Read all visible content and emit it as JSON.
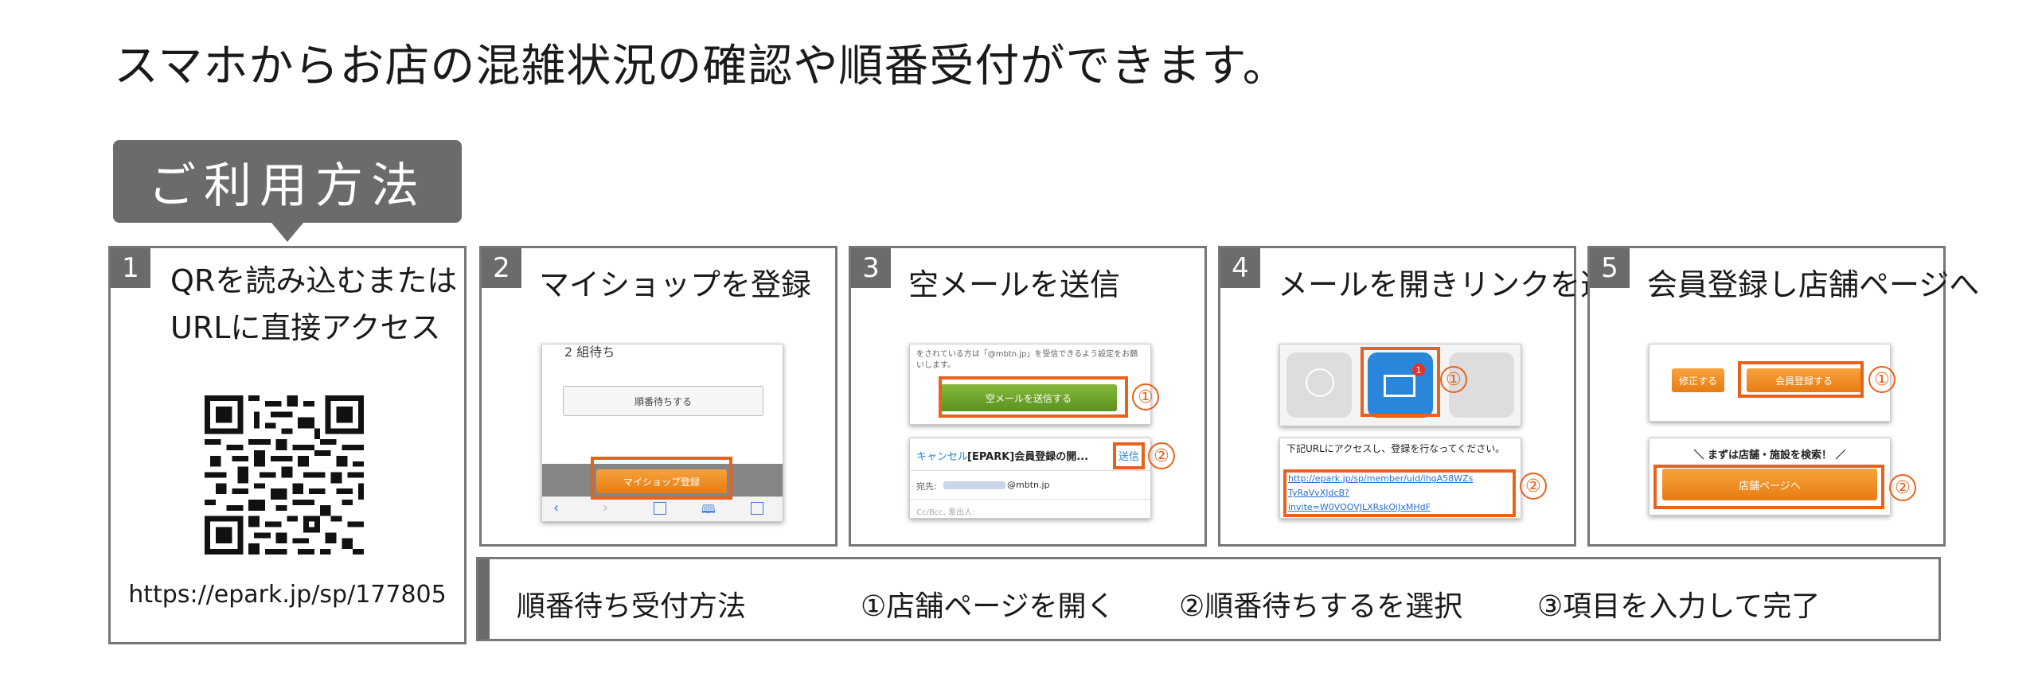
{
  "headline": "スマホからお店の混雑状況の確認や順番受付ができます。",
  "usage_label": "ご利用方法",
  "steps": [
    {
      "num": "1",
      "title_line1": "QRを読み込むまたは",
      "title_line2": "URLに直接アクセス",
      "url": "https://epark.jp/sp/177805"
    },
    {
      "num": "2",
      "title": "マイショップを登録",
      "shot": {
        "top_text": "2 組待ち",
        "button": "順番待ちする",
        "highlight": "マイショップ登録"
      }
    },
    {
      "num": "3",
      "title": "空メールを送信",
      "shot": {
        "notice": "をされている方は「@mbtn.jp」を受信できるよう設定をお願いします。",
        "green_button": "空メールを送信する",
        "cancel": "キャンセル",
        "subject": "[EPARK]会員登録の開...",
        "send": "送信",
        "to_label": "宛先:",
        "to_domain": "@mbtn.jp",
        "cc_label": "Cc/Bcc, 差出人:"
      }
    },
    {
      "num": "4",
      "title": "メールを開きリンクを選択",
      "shot": {
        "badge": "1",
        "text": "下記URLにアクセスし、登録を行なってください。",
        "link1": "http://epark.jp/sp/member/uid/ihgA58WZs",
        "link2": "TyRaVvXJdcB?",
        "link3": "invite=W0VOOVJLXRskOiJxMHdF"
      }
    },
    {
      "num": "5",
      "title": "会員登録し店舗ページへ",
      "shot": {
        "edit": "修正する",
        "register": "会員登録する",
        "search": "＼ まずは店舗・施設を検索！ ／",
        "store": "店舗ページへ"
      }
    }
  ],
  "markers": {
    "one": "①",
    "two": "②"
  },
  "queue": {
    "title": "順番待ち受付方法",
    "step1": "①店舗ページを開く",
    "step2": "②順番待ちするを選択",
    "step3": "③項目を入力して完了"
  },
  "colors": {
    "accent": "#e8621c",
    "panel_gray": "#6b6b6b",
    "border": "#777777",
    "orange_button": "#ef8d25",
    "green_button": "#6fa32c",
    "mail_blue": "#2a86d8"
  },
  "icons": [
    "qr-code-icon",
    "globe-icon",
    "mail-icon",
    "grid-icon",
    "back-arrow-icon",
    "forward-arrow-icon",
    "share-icon",
    "bookmarks-icon",
    "tabs-icon"
  ]
}
